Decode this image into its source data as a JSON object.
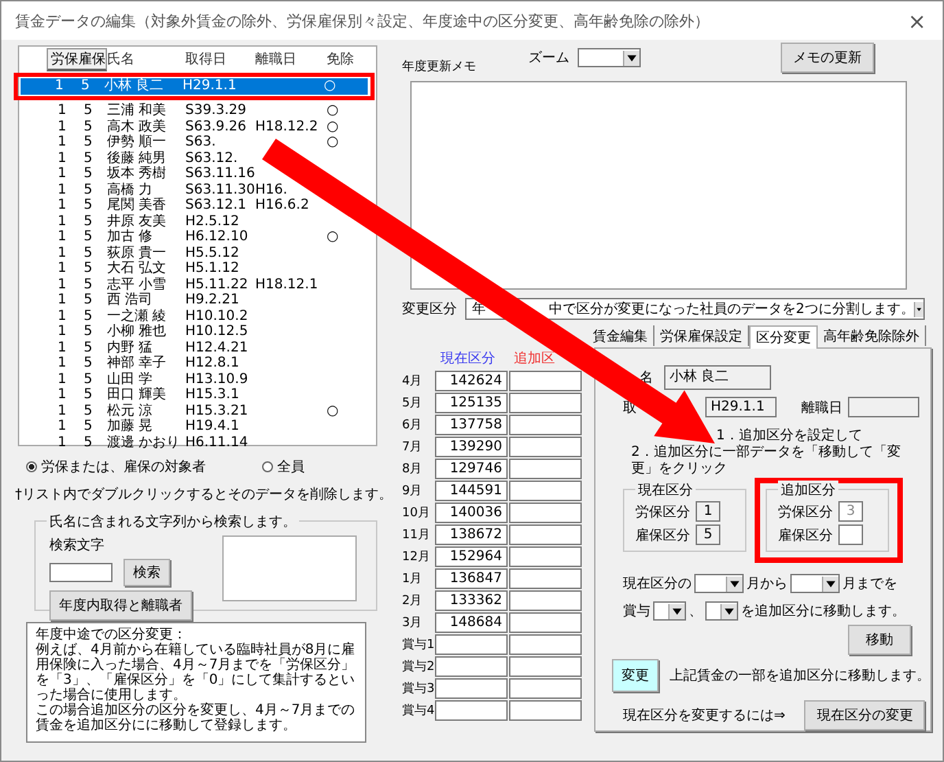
{
  "window": {
    "title": "賃金データの編集（対象外賃金の除外、労保雇保別々設定、年度途中の区分変更、高年齢免除の除外）",
    "close": "×"
  },
  "list": {
    "tab": "労保雇保",
    "columns": [
      "氏名",
      "取得日",
      "離職日",
      "免除"
    ],
    "rows": [
      {
        "column_1": "1",
        "column_2": "5",
        "name": "小林 良二",
        "acquired": "H29.1.1",
        "exempt": "○",
        "selected": true
      },
      {
        "column_1": "1",
        "column_2": "5",
        "name": "三浦 和美",
        "acquired": "S39.3.29",
        "exempt": "○",
        "selected": false
      },
      {
        "column_1": "1",
        "column_2": "5",
        "name": "高木 政美",
        "acquired": "S63.9.26",
        "resigned": "H18.12.2",
        "exempt": "○",
        "selected": false
      },
      {
        "column_1": "1",
        "column_2": "5",
        "name": "伊勢 順一",
        "acquired": "S63.",
        "exempt": "○",
        "selected": false
      },
      {
        "column_1": "1",
        "column_2": "5",
        "name": "後藤 純男",
        "acquired": "S63.12.",
        "selected": false
      },
      {
        "column_1": "1",
        "column_2": "5",
        "name": "坂本 秀樹",
        "acquired": "S63.11.16",
        "selected": false
      },
      {
        "column_1": "1",
        "column_2": "5",
        "name": "高橋 力",
        "acquired": "S63.11.30",
        "resigned": "H16.",
        "selected": false
      },
      {
        "column_1": "1",
        "column_2": "5",
        "name": "尾関 美香",
        "acquired": "S63.12.1",
        "resigned": "H16.6.2",
        "selected": false
      },
      {
        "column_1": "1",
        "column_2": "5",
        "name": "井原 友美",
        "acquired": "H2.5.12",
        "selected": false
      },
      {
        "column_1": "1",
        "column_2": "5",
        "name": "加古 修",
        "acquired": "H6.12.10",
        "exempt": "○",
        "selected": false
      },
      {
        "column_1": "1",
        "column_2": "5",
        "name": "荻原 貴一",
        "acquired": "H5.5.12",
        "selected": false
      },
      {
        "column_1": "1",
        "column_2": "5",
        "name": "大石 弘文",
        "acquired": "H5.1.12",
        "selected": false
      },
      {
        "column_1": "1",
        "column_2": "5",
        "name": "志平 小雪",
        "acquired": "H5.11.22",
        "resigned": "H18.12.1",
        "selected": false
      },
      {
        "column_1": "1",
        "column_2": "5",
        "name": "西 浩司",
        "acquired": "H9.2.21",
        "selected": false
      },
      {
        "column_1": "1",
        "column_2": "5",
        "name": "一之瀬 綾",
        "acquired": "H10.10.2",
        "selected": false
      },
      {
        "column_1": "1",
        "column_2": "5",
        "name": "小柳 雅也",
        "acquired": "H10.12.5",
        "selected": false
      },
      {
        "column_1": "1",
        "column_2": "5",
        "name": "内野 猛",
        "acquired": "H12.4.21",
        "selected": false
      },
      {
        "column_1": "1",
        "column_2": "5",
        "name": "神部 幸子",
        "acquired": "H12.8.1",
        "selected": false
      },
      {
        "column_1": "1",
        "column_2": "5",
        "name": "山田 学",
        "acquired": "H13.10.9",
        "selected": false
      },
      {
        "column_1": "1",
        "column_2": "5",
        "name": "田口 輝美",
        "acquired": "H15.3.1",
        "selected": false
      },
      {
        "column_1": "1",
        "column_2": "5",
        "name": "松元 涼",
        "acquired": "H15.3.21",
        "exempt": "○",
        "selected": false
      },
      {
        "column_1": "1",
        "column_2": "5",
        "name": "加藤 晃",
        "acquired": "H19.4.1",
        "selected": false
      },
      {
        "column_1": "1",
        "column_2": "5",
        "name": "渡邊 かおり",
        "acquired": "H6.11.14",
        "selected": false
      }
    ]
  },
  "filter": [
    {
      "label": "労保または、雇保の対象者",
      "selected": true
    },
    {
      "label": "全員",
      "selected": false
    }
  ],
  "delete_note": "†リスト内でダブルクリックするとそのデータを削除します。",
  "search": {
    "legend": "氏名に含まれる文字列から検索します。",
    "label": "検索文字",
    "button": "検索",
    "list_button": "年度内取得と離職者"
  },
  "explanation": [
    "年度中途での区分変更：",
    "例えば、4月前から在籍している臨時社員が8月に雇用保険に入った場合、4月～7月までを「労保区分」を「3」、「雇保区分」を「0」にして集計するといった場合に使用します。",
    "この場合追加区分の区分を変更し、4月～7月までの賃金を追加区分にに移動して登録します。"
  ],
  "memo": {
    "label": "年度更新メモ",
    "zoom_label": "ズーム",
    "update_button": "メモの更新"
  },
  "change_type": {
    "label": "変更区分",
    "value_parts": [
      "年",
      "中で区分が変更になった社員のデータを2つに分割します。"
    ]
  },
  "wages": {
    "headers": [
      "現在区分",
      "追加区"
    ],
    "rows": [
      {
        "month": "4月",
        "current": "142624"
      },
      {
        "month": "5月",
        "current": "125135"
      },
      {
        "month": "6月",
        "current": "137758"
      },
      {
        "month": "7月",
        "current": "139290"
      },
      {
        "month": "8月",
        "current": "129746"
      },
      {
        "month": "9月",
        "current": "144591"
      },
      {
        "month": "10月",
        "current": "140036"
      },
      {
        "month": "11月",
        "current": "138672"
      },
      {
        "month": "12月",
        "current": "152964"
      },
      {
        "month": "1月",
        "current": "136847"
      },
      {
        "month": "2月",
        "current": "133362"
      },
      {
        "month": "3月",
        "current": "148684"
      },
      {
        "month": "賞与1"
      },
      {
        "month": "賞与2"
      },
      {
        "month": "賞与3"
      },
      {
        "month": "賞与4"
      }
    ]
  },
  "tabs": [
    {
      "label": "賃金編集",
      "selected": false
    },
    {
      "label": "労保雇保設定",
      "selected": false
    },
    {
      "label": "区分変更",
      "selected": true
    },
    {
      "label": "高年齢免除除外",
      "selected": false
    }
  ],
  "panel": {
    "name_label": "名",
    "name": "小林 良二",
    "acquired_label": "取",
    "acquired": "H29.1.1",
    "resigned_label": "離職日",
    "steps": [
      "1．追加区分を設定して",
      "2．追加区分に一部データを「移動して「変更」をクリック"
    ],
    "current_group": {
      "legend": "現在区分",
      "labor_label": "労保区分",
      "labor": "1",
      "employment_label": "雇保区分",
      "employment": "5"
    },
    "added_group": {
      "legend": "追加区分",
      "labor_label": "労保区分",
      "labor": "3",
      "employment_label": "雇保区分"
    },
    "range_prefix": "現在区分の",
    "range_from": "月から",
    "range_to": "月までを",
    "bonus_prefix": "賞与",
    "bonus_sep": "、",
    "bonus_suffix": "を追加区分に移動します。",
    "move_button": "移動",
    "change_button": "変更",
    "change_note": "上記賃金の一部を追加区分に移動します。",
    "current_note": "現在区分を変更するには⇒",
    "current_button": "現在区分の変更"
  }
}
